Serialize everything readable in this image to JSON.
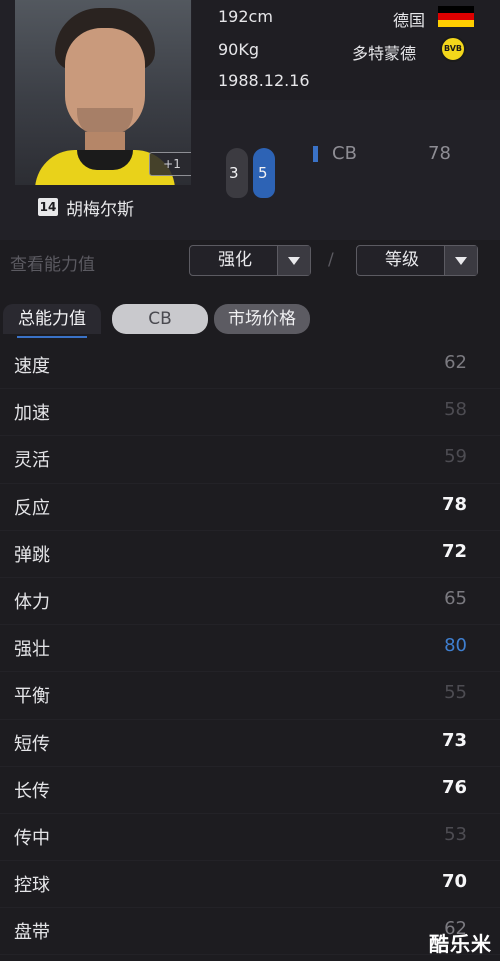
{
  "player": {
    "height": "192cm",
    "weight": "90Kg",
    "birthdate": "1988.12.16",
    "nationality": "德国",
    "club": "多特蒙德",
    "club_logo_text": "BVB",
    "name": "胡梅尔斯",
    "number": "14",
    "upgrade_badge": "+1",
    "left_foot": "3",
    "right_foot": "5",
    "position": "CB",
    "position_rating": "78",
    "flag_colors": [
      "#000000",
      "#dd0000",
      "#ffce00"
    ]
  },
  "filter": {
    "label": "查看能力值",
    "dropdown1": "强化",
    "separator": "/",
    "dropdown2": "等级"
  },
  "tabs": [
    {
      "label": "总能力值",
      "active": true
    },
    {
      "label": "CB",
      "active": false
    },
    {
      "label": "市场价格",
      "active": false
    }
  ],
  "stats": [
    {
      "name": "速度",
      "value": "62",
      "style": "dim"
    },
    {
      "name": "加速",
      "value": "58",
      "style": "faint"
    },
    {
      "name": "灵活",
      "value": "59",
      "style": "faint"
    },
    {
      "name": "反应",
      "value": "78",
      "style": "bright"
    },
    {
      "name": "弹跳",
      "value": "72",
      "style": "bright"
    },
    {
      "name": "体力",
      "value": "65",
      "style": "dim"
    },
    {
      "name": "强壮",
      "value": "80",
      "style": "blue"
    },
    {
      "name": "平衡",
      "value": "55",
      "style": "faint"
    },
    {
      "name": "短传",
      "value": "73",
      "style": "bright"
    },
    {
      "name": "长传",
      "value": "76",
      "style": "bright"
    },
    {
      "name": "传中",
      "value": "53",
      "style": "faint"
    },
    {
      "name": "控球",
      "value": "70",
      "style": "bright"
    },
    {
      "name": "盘带",
      "value": "62",
      "style": "dim"
    }
  ],
  "watermark": "酷乐米",
  "colors": {
    "accent_blue": "#3a72c7",
    "background": "#1d1c20"
  }
}
